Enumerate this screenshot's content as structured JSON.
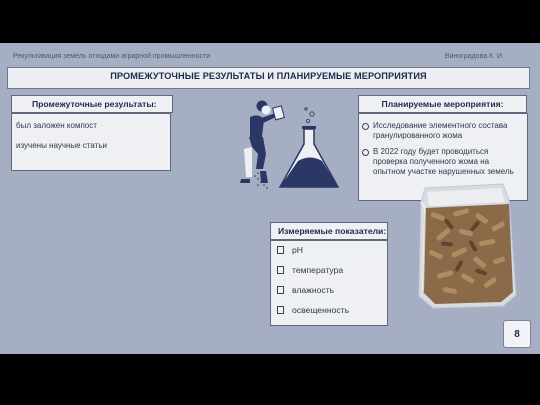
{
  "header": {
    "left": "Рекультивация земель отходами аграрной промышленности",
    "right": "Виноградова К. И."
  },
  "title": "ПРОМЕЖУТОЧНЫЕ РЕЗУЛЬТАТЫ И ПЛАНИРУЕМЫЕ МЕРОПРИЯТИЯ",
  "intermediate": {
    "label": "Промежуточные результаты:",
    "items": [
      "был заложен компост",
      "изучены научные статьи"
    ]
  },
  "planned": {
    "label": "Планируемые мероприятия:",
    "items": [
      "Исследование элементного состава гранулированного жома",
      "В 2022 году будет проводиться проверка полученного жома на опытном участке нарушенных земель"
    ]
  },
  "measured": {
    "label": "Измеряемые показатели:",
    "items": [
      "pH",
      "температура",
      "влажность",
      "освещенность"
    ]
  },
  "page_number": "8",
  "icons": [
    "scientist-illustration",
    "flask-illustration",
    "granule-bag-photo"
  ],
  "colors": {
    "slide_bg": "#a6aec3",
    "title_text": "#1f2b4d",
    "illustration": "#2b3764"
  }
}
